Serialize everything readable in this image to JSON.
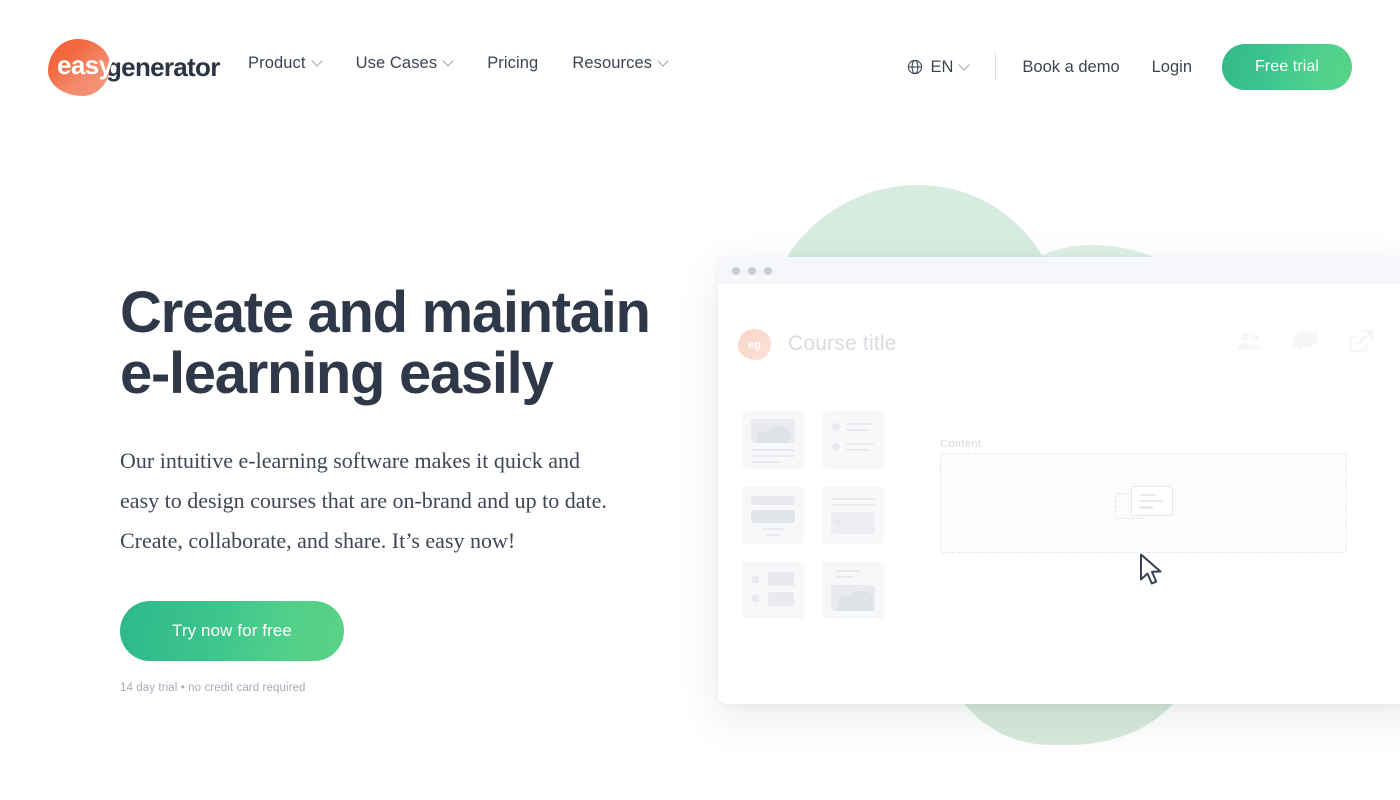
{
  "brand": {
    "logo_easy": "easy",
    "logo_generator": "generator",
    "accent_orange": "#f4623a",
    "accent_green": "#3cc490",
    "text_dark": "#2f3848"
  },
  "header": {
    "nav": [
      {
        "label": "Product",
        "has_chevron": true
      },
      {
        "label": "Use Cases",
        "has_chevron": true
      },
      {
        "label": "Pricing",
        "has_chevron": false
      },
      {
        "label": "Resources",
        "has_chevron": true
      }
    ],
    "language": {
      "code": "EN",
      "icon": "globe-icon",
      "has_chevron": true
    },
    "book_demo": "Book a demo",
    "login": "Login",
    "free_trial": "Free trial"
  },
  "hero": {
    "headline": "Create and maintain\ne-learning easily",
    "subhead": "Our intuitive e-learning software makes it quick and easy to design courses that are on-brand and up to date. Create, collaborate, and share. It’s easy now!",
    "cta_label": "Try now for free",
    "cta_note": "14 day trial • no credit card required"
  },
  "mockup": {
    "window_dots": 3,
    "logo_badge": "eg",
    "course_title_placeholder": "Course title",
    "toolbar_icons": [
      "users-icon",
      "comment-icon",
      "share-icon"
    ],
    "template_cards": 6,
    "content_label": "Content",
    "dropzone_icon": "drag-drop-content-icon",
    "cursor": "mouse-pointer-icon"
  }
}
